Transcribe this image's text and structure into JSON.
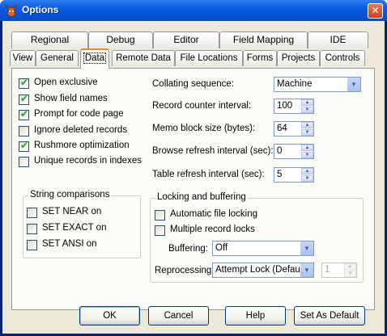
{
  "window": {
    "title": "Options",
    "close_glyph": "✕"
  },
  "tabs": {
    "row1": [
      "Regional",
      "Debug",
      "Editor",
      "Field Mapping",
      "IDE"
    ],
    "row2": [
      "View",
      "General",
      "Data",
      "Remote Data",
      "File Locations",
      "Forms",
      "Projects",
      "Controls"
    ],
    "active": "Data"
  },
  "options": {
    "open_exclusive": {
      "label": "Open exclusive",
      "checked": true
    },
    "show_field_names": {
      "label": "Show field names",
      "checked": true
    },
    "prompt_code_page": {
      "label": "Prompt for code page",
      "checked": true
    },
    "ignore_deleted": {
      "label": "Ignore deleted records",
      "checked": false
    },
    "rushmore": {
      "label": "Rushmore optimization",
      "checked": true
    },
    "unique_records": {
      "label": "Unique records in indexes",
      "checked": false
    }
  },
  "string_comparisons": {
    "title": "String comparisons",
    "set_near": {
      "label": "SET NEAR on",
      "checked": false
    },
    "set_exact": {
      "label": "SET EXACT on",
      "checked": false
    },
    "set_ansi": {
      "label": "SET ANSI on",
      "checked": false
    }
  },
  "fields": {
    "collating": {
      "label": "Collating sequence:",
      "value": "Machine"
    },
    "record_counter": {
      "label": "Record counter interval:",
      "value": "100"
    },
    "memo_block": {
      "label": "Memo block size (bytes):",
      "value": "64"
    },
    "browse_refresh": {
      "label": "Browse refresh interval (sec):",
      "value": "0"
    },
    "table_refresh": {
      "label": "Table refresh interval (sec):",
      "value": "5"
    }
  },
  "locking": {
    "title": "Locking and buffering",
    "auto_file_locking": {
      "label": "Automatic file locking",
      "checked": false
    },
    "multiple_record_locks": {
      "label": "Multiple record locks",
      "checked": false
    },
    "buffering": {
      "label": "Buffering:",
      "value": "Off"
    },
    "reprocessing": {
      "label": "Reprocessing:",
      "value": "Attempt Lock (Default)",
      "count": "1"
    }
  },
  "buttons": {
    "ok": "OK",
    "cancel": "Cancel",
    "help": "Help",
    "set_default": "Set As Default"
  },
  "icons": {
    "check": "✔",
    "up": "▲",
    "down": "▼"
  }
}
